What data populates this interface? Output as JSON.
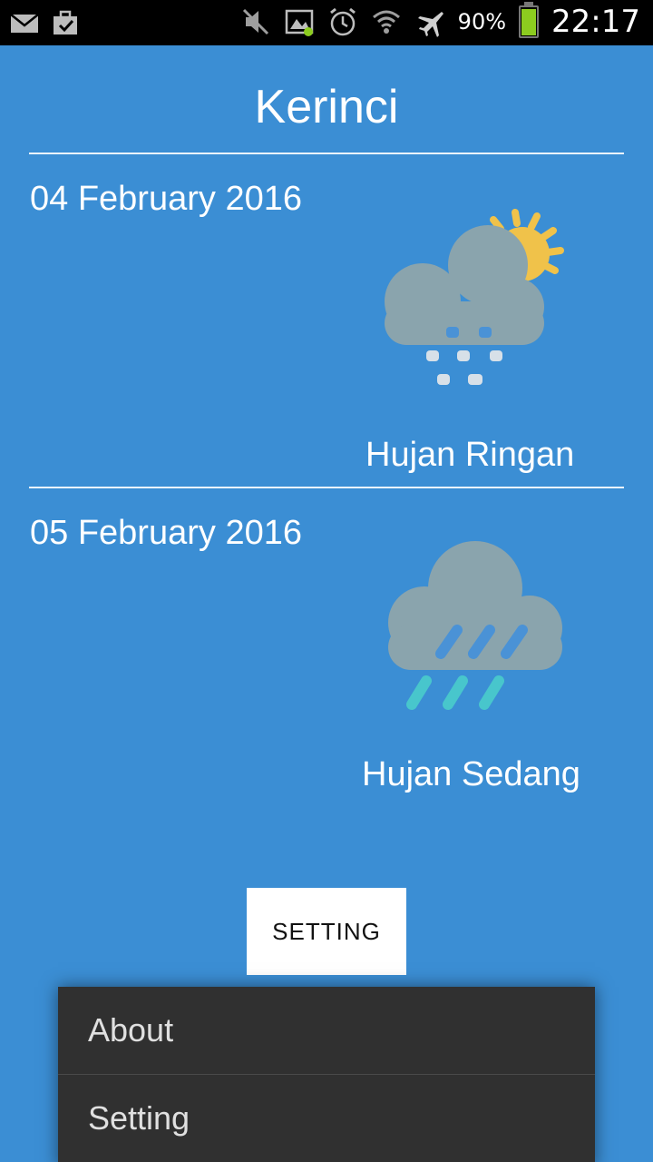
{
  "status_bar": {
    "battery_percent": "90%",
    "time": "22:17",
    "battery_level": 0.9,
    "icons": [
      "mail-icon",
      "briefcase-check-icon",
      "mute-icon",
      "screenshot-icon",
      "alarm-icon",
      "wifi-icon",
      "airplane-mode-icon",
      "battery-icon"
    ]
  },
  "location": {
    "title": "Kerinci"
  },
  "forecasts": [
    {
      "date": "04 February 2016",
      "condition": "Hujan Ringan",
      "icon": "light-rain-sun-icon"
    },
    {
      "date": "05 February 2016",
      "condition": "Hujan Sedang",
      "icon": "moderate-rain-icon"
    }
  ],
  "setting_button": {
    "label": "SETTING"
  },
  "menu": {
    "items": [
      "About",
      "Setting"
    ]
  },
  "colors": {
    "background": "#3b8ed4",
    "cloud": "#8aa4ad",
    "sun": "#f0c24a",
    "rain_drop": "#4a92d6",
    "rain_drop_light": "#48c6cc",
    "menu_bg": "#303030",
    "battery": "#8ccc1f"
  }
}
